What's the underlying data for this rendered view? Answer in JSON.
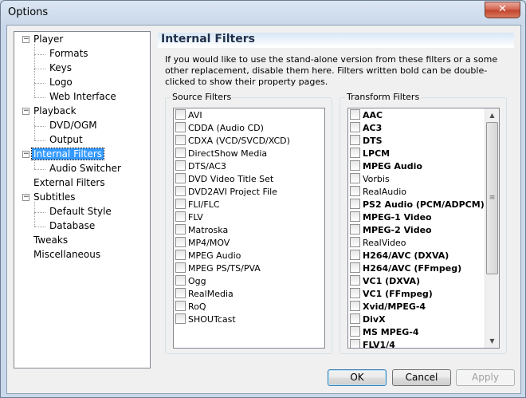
{
  "window": {
    "title": "Options",
    "close_glyph": "✕"
  },
  "tree": [
    {
      "label": "Player",
      "level": 0,
      "expander": "−"
    },
    {
      "label": "Formats",
      "level": 1
    },
    {
      "label": "Keys",
      "level": 1
    },
    {
      "label": "Logo",
      "level": 1
    },
    {
      "label": "Web Interface",
      "level": 1
    },
    {
      "label": "Playback",
      "level": 0,
      "expander": "−"
    },
    {
      "label": "DVD/OGM",
      "level": 1
    },
    {
      "label": "Output",
      "level": 1
    },
    {
      "label": "Internal Filters",
      "level": 0,
      "expander": "−",
      "selected": true
    },
    {
      "label": "Audio Switcher",
      "level": 1
    },
    {
      "label": "External Filters",
      "level": 0
    },
    {
      "label": "Subtitles",
      "level": 0,
      "expander": "−"
    },
    {
      "label": "Default Style",
      "level": 1
    },
    {
      "label": "Database",
      "level": 1
    },
    {
      "label": "Tweaks",
      "level": 0
    },
    {
      "label": "Miscellaneous",
      "level": 0
    }
  ],
  "panel": {
    "title": "Internal Filters",
    "description": "If you would like to use the stand-alone version from these filters or a some other replacement, disable them here. Filters written bold can be double-clicked to show their property pages."
  },
  "source_filters": {
    "legend": "Source Filters",
    "items": [
      {
        "label": "AVI",
        "bold": false
      },
      {
        "label": "CDDA (Audio CD)",
        "bold": false
      },
      {
        "label": "CDXA (VCD/SVCD/XCD)",
        "bold": false
      },
      {
        "label": "DirectShow Media",
        "bold": false
      },
      {
        "label": "DTS/AC3",
        "bold": false
      },
      {
        "label": "DVD Video Title Set",
        "bold": false
      },
      {
        "label": "DVD2AVI Project File",
        "bold": false
      },
      {
        "label": "FLI/FLC",
        "bold": false
      },
      {
        "label": "FLV",
        "bold": false
      },
      {
        "label": "Matroska",
        "bold": false
      },
      {
        "label": "MP4/MOV",
        "bold": false
      },
      {
        "label": "MPEG Audio",
        "bold": false
      },
      {
        "label": "MPEG PS/TS/PVA",
        "bold": false
      },
      {
        "label": "Ogg",
        "bold": false
      },
      {
        "label": "RealMedia",
        "bold": false
      },
      {
        "label": "RoQ",
        "bold": false
      },
      {
        "label": "SHOUTcast",
        "bold": false
      }
    ]
  },
  "transform_filters": {
    "legend": "Transform Filters",
    "items": [
      {
        "label": "AAC",
        "bold": true
      },
      {
        "label": "AC3",
        "bold": true
      },
      {
        "label": "DTS",
        "bold": true
      },
      {
        "label": "LPCM",
        "bold": true
      },
      {
        "label": "MPEG Audio",
        "bold": true
      },
      {
        "label": "Vorbis",
        "bold": false
      },
      {
        "label": "RealAudio",
        "bold": false
      },
      {
        "label": "PS2 Audio (PCM/ADPCM)",
        "bold": true
      },
      {
        "label": "MPEG-1 Video",
        "bold": true
      },
      {
        "label": "MPEG-2 Video",
        "bold": true
      },
      {
        "label": "RealVideo",
        "bold": false
      },
      {
        "label": "H264/AVC (DXVA)",
        "bold": true
      },
      {
        "label": "H264/AVC (FFmpeg)",
        "bold": true
      },
      {
        "label": "VC1 (DXVA)",
        "bold": true
      },
      {
        "label": "VC1 (FFmpeg)",
        "bold": true
      },
      {
        "label": "Xvid/MPEG-4",
        "bold": true
      },
      {
        "label": "DivX",
        "bold": true
      },
      {
        "label": "MS MPEG-4",
        "bold": true
      },
      {
        "label": "FLV1/4",
        "bold": true
      }
    ],
    "scroll": {
      "up": "▲",
      "down": "▼",
      "grip": "≡"
    }
  },
  "buttons": {
    "ok": "OK",
    "cancel": "Cancel",
    "apply": "Apply"
  }
}
